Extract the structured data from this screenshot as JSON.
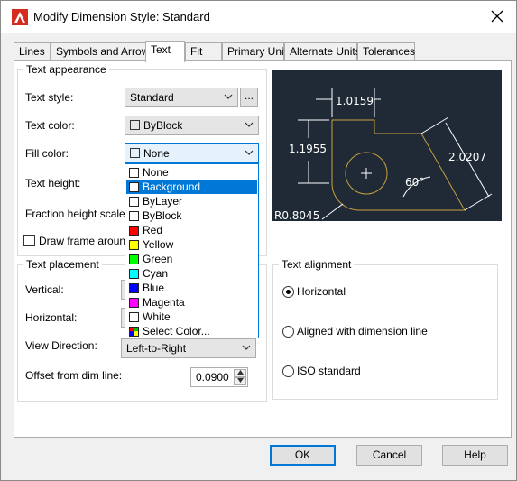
{
  "window": {
    "title": "Modify Dimension Style: Standard"
  },
  "tabs": [
    "Lines",
    "Symbols and Arrows",
    "Text",
    "Fit",
    "Primary Units",
    "Alternate Units",
    "Tolerances"
  ],
  "text_appearance": {
    "group_label": "Text appearance",
    "text_style_label": "Text style:",
    "text_style_value": "Standard",
    "browse_label": "...",
    "text_color_label": "Text color:",
    "text_color_value": "ByBlock",
    "fill_color_label": "Fill color:",
    "fill_color_value": "None",
    "text_height_label": "Text height:",
    "fraction_height_label": "Fraction height scale:",
    "draw_frame_label": "Draw frame around t"
  },
  "fill_color_dropdown": {
    "items": [
      {
        "label": "None",
        "color": "#ffffff"
      },
      {
        "label": "Background",
        "color": "#ffffff"
      },
      {
        "label": "ByLayer",
        "color": "#ffffff"
      },
      {
        "label": "ByBlock",
        "color": "#ffffff"
      },
      {
        "label": "Red",
        "color": "#ff0000"
      },
      {
        "label": "Yellow",
        "color": "#ffff00"
      },
      {
        "label": "Green",
        "color": "#00ff00"
      },
      {
        "label": "Cyan",
        "color": "#00ffff"
      },
      {
        "label": "Blue",
        "color": "#0000ff"
      },
      {
        "label": "Magenta",
        "color": "#ff00ff"
      },
      {
        "label": "White",
        "color": "#ffffff"
      },
      {
        "label": "Select Color...",
        "color": "multi"
      }
    ],
    "selected": "Background"
  },
  "text_placement": {
    "group_label": "Text placement",
    "vertical_label": "Vertical:",
    "horizontal_label": "Horizontal:",
    "view_direction_label": "View Direction:",
    "view_direction_value": "Left-to-Right",
    "offset_label": "Offset from dim line:",
    "offset_value": "0.0900"
  },
  "text_alignment": {
    "group_label": "Text alignment",
    "options": [
      "Horizontal",
      "Aligned with dimension line",
      "ISO standard"
    ],
    "selected": "Horizontal"
  },
  "preview": {
    "dim_top": "1.0159",
    "dim_left": "1.1955",
    "dim_right": "2.0207",
    "dim_angle": "60°",
    "dim_radius": "R0.8045"
  },
  "buttons": {
    "ok": "OK",
    "cancel": "Cancel",
    "help": "Help"
  },
  "colors": {
    "accent": "#0078d7",
    "preview_bg": "#1f2a36",
    "geometry": "#c8a040"
  }
}
